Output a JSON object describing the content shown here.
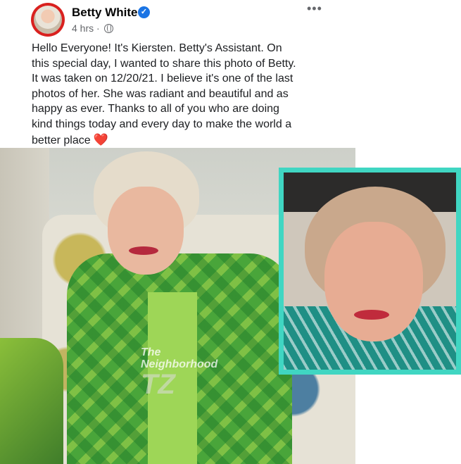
{
  "post": {
    "author": "Betty White",
    "verified_icon": "verified-badge-icon",
    "time": "4 hrs",
    "separator": "·",
    "audience_icon": "globe-icon",
    "more_label": "•••",
    "text_lines": [
      "Hello Everyone!  It's Kiersten.  Betty's Assistant.  On",
      "this special day, I wanted to share this photo of Betty.",
      "It was taken on 12/20/21.  I believe it's one of the last",
      "photos of her.  She was radiant and beautiful and as",
      "happy as ever.  Thanks to all of you who are doing",
      "kind things today and every day to make the world a",
      "better place"
    ],
    "heart": "❤️"
  },
  "photo": {
    "watermark_line1": "The",
    "watermark_line2": "Neighborhood",
    "watermark_logo": "TZ"
  },
  "colors": {
    "inset_border": "#40d6c2",
    "verified": "#1b74e4",
    "avatar_ring": "#d9211f"
  }
}
